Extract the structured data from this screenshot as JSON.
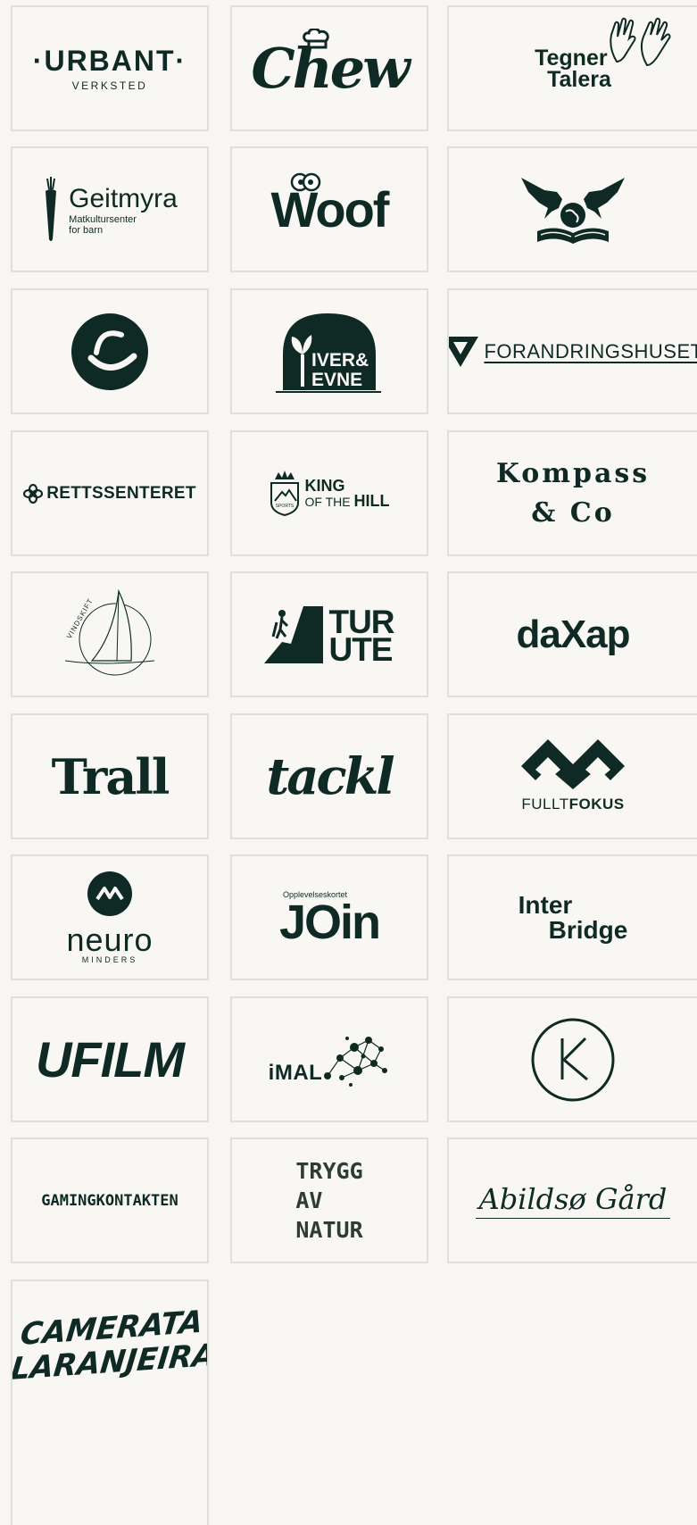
{
  "logos": {
    "urbant": {
      "main": "·URBANT·",
      "sub": "VERKSTED"
    },
    "chew": {
      "name": "Chew"
    },
    "tegner": {
      "line1": "Tegner",
      "line2": "Talera"
    },
    "geitmyra": {
      "name": "Geitmyra",
      "line1": "Matkultursenter",
      "line2": "for barn"
    },
    "woof": {
      "name": "Woof"
    },
    "eagles": {
      "icon": "eagles-book-icon"
    },
    "e_circle": {
      "icon": "e-circle-icon"
    },
    "iver": {
      "line1": "IVER&",
      "line2": "EVNE"
    },
    "forandring": {
      "name": "FORANDRINGSHUSET"
    },
    "retts": {
      "name": "RETTSSENTERET"
    },
    "king": {
      "line1": "KING",
      "of_the": "OF THE",
      "hill": "HILL",
      "badge": "SPORTS"
    },
    "kompass": {
      "line1": "Kompass",
      "line2": "& Co"
    },
    "vindskift": {
      "name": "VINDSKIFT"
    },
    "turute": {
      "line1": "TUR",
      "line2": "UTE"
    },
    "daxap": {
      "name": "daXap"
    },
    "trall": {
      "name": "Trall"
    },
    "tackl": {
      "name": "tackl"
    },
    "fullfokus": {
      "full": "FULLT",
      "fokus": "FOKUS"
    },
    "neuro": {
      "name": "neuro",
      "sub": "MINDERS"
    },
    "join": {
      "small": "Opplevelseskortet",
      "name": "JOin"
    },
    "interbridge": {
      "line1": "Inter",
      "line2": "Bridge"
    },
    "ufilm": {
      "name": "UFILM"
    },
    "imal": {
      "name": "iMAL"
    },
    "k_circle": {
      "icon": "k-circle-icon"
    },
    "gaming": {
      "name": "GAMINGKONTAKTEN"
    },
    "trygg": {
      "line1": "TRYGG",
      "line2": "AV",
      "line3": "NATUR"
    },
    "abildso": {
      "name": "Abildsø Gård"
    },
    "camerata": {
      "line1": "CAMERATA",
      "line2": "LARANJEIRAS"
    }
  }
}
